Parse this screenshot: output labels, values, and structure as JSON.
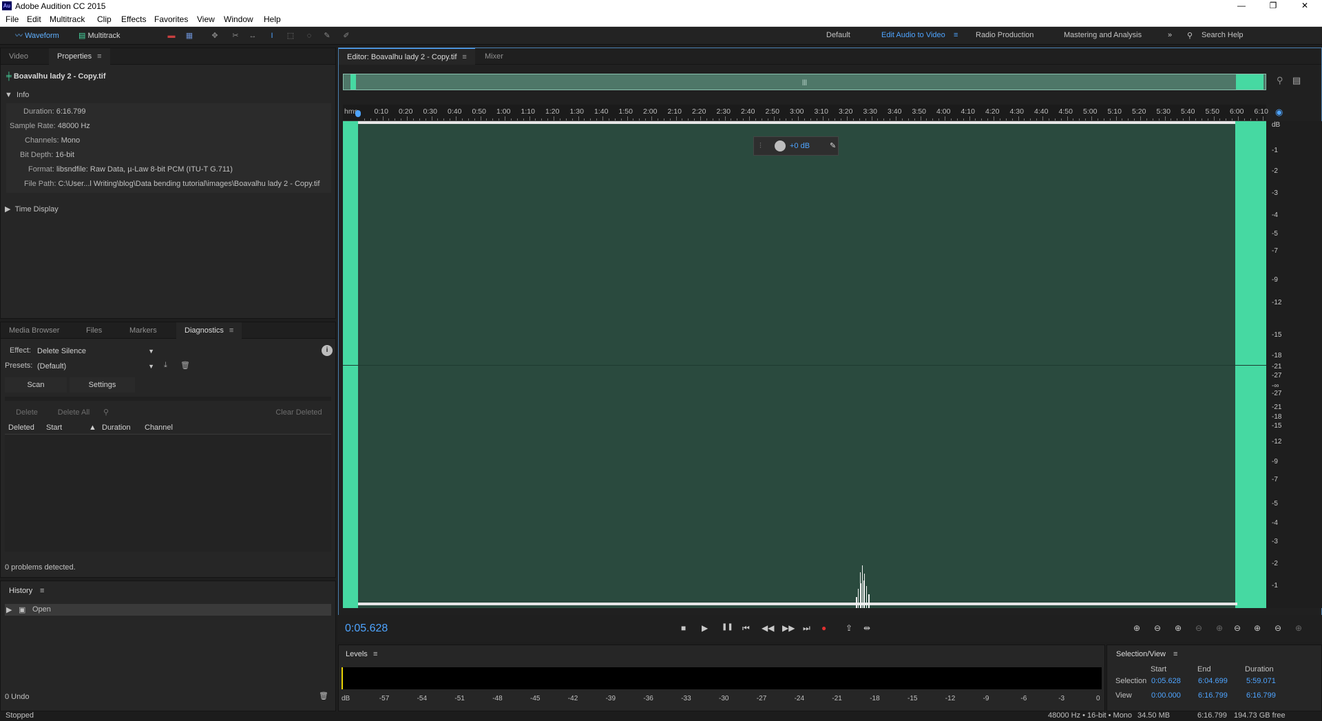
{
  "window": {
    "title": "Adobe Audition CC 2015",
    "logo": "Au"
  },
  "menu": [
    "File",
    "Edit",
    "Multitrack",
    "Clip",
    "Effects",
    "Favorites",
    "View",
    "Window",
    "Help"
  ],
  "toolbar": {
    "waveform": "Waveform",
    "multitrack": "Multitrack",
    "workspaces": [
      "Default",
      "Edit Audio to Video",
      "Radio Production",
      "Mastering and Analysis"
    ],
    "active_workspace": "Edit Audio to Video",
    "overflow": "»",
    "search": "Search Help"
  },
  "properties": {
    "tabs": [
      "Video",
      "Properties"
    ],
    "file_name": "Boavalhu lady 2 - Copy.tif",
    "info_heading": "Info",
    "info": [
      {
        "label": "Duration:",
        "value": "6:16.799"
      },
      {
        "label": "Sample Rate:",
        "value": "48000 Hz"
      },
      {
        "label": "Channels:",
        "value": "Mono"
      },
      {
        "label": "Bit Depth:",
        "value": "16-bit"
      },
      {
        "label": "Format:",
        "value": "libsndfile: Raw Data, µ-Law 8-bit PCM (ITU-T G.711)"
      },
      {
        "label": "File Path:",
        "value": "C:\\User...l Writing\\blog\\Data bending tutorial\\images\\Boavalhu lady 2 - Copy.tif"
      }
    ],
    "time_display": "Time Display"
  },
  "diagnostics": {
    "tabs": [
      "Media Browser",
      "Files",
      "Markers",
      "Diagnostics"
    ],
    "effect_label": "Effect:",
    "effect_value": "Delete Silence",
    "presets_label": "Presets:",
    "presets_value": "(Default)",
    "scan": "Scan",
    "settings": "Settings",
    "delete": "Delete",
    "delete_all": "Delete All",
    "clear_deleted": "Clear Deleted",
    "columns": [
      "Deleted",
      "Start",
      "Duration",
      "Channel"
    ],
    "status": "0 problems detected."
  },
  "history": {
    "title": "History",
    "items": [
      "Open"
    ],
    "undo": "0 Undo"
  },
  "editor": {
    "tab": "Editor: Boavalhu lady 2 - Copy.tif",
    "mixer": "Mixer",
    "ruler_unit": "hms",
    "ruler": [
      "0:10",
      "0:20",
      "0:30",
      "0:40",
      "0:50",
      "1:00",
      "1:10",
      "1:20",
      "1:30",
      "1:40",
      "1:50",
      "2:00",
      "2:10",
      "2:20",
      "2:30",
      "2:40",
      "2:50",
      "3:00",
      "3:10",
      "3:20",
      "3:30",
      "3:40",
      "3:50",
      "4:00",
      "4:10",
      "4:20",
      "4:30",
      "4:40",
      "4:50",
      "5:00",
      "5:10",
      "5:20",
      "5:30",
      "5:40",
      "5:50",
      "6:00",
      "6:10"
    ],
    "db_label": "dB",
    "db_scale": [
      "-1",
      "-2",
      "-3",
      "-4",
      "-5",
      "-7",
      "-9",
      "-12",
      "-15",
      "-18",
      "-21",
      "-27",
      "-∞",
      "-27",
      "-21",
      "-18",
      "-15",
      "-12",
      "-9",
      "-7",
      "-5",
      "-4",
      "-3",
      "-2",
      "-1"
    ],
    "hud_gain": "+0 dB",
    "timecode": "0:05.628",
    "transport": [
      "■",
      "▶",
      "❚❚",
      "⏮",
      "◀◀",
      "▶▶",
      "⏭",
      "●",
      "⇪",
      "⇹"
    ]
  },
  "levels": {
    "title": "Levels",
    "scale": [
      "dB",
      "-57",
      "-54",
      "-51",
      "-48",
      "-45",
      "-42",
      "-39",
      "-36",
      "-33",
      "-30",
      "-27",
      "-24",
      "-21",
      "-18",
      "-15",
      "-12",
      "-9",
      "-6",
      "-3",
      "0"
    ]
  },
  "selection_view": {
    "title": "Selection/View",
    "headers": [
      "Start",
      "End",
      "Duration"
    ],
    "selection_label": "Selection",
    "selection": [
      "0:05.628",
      "6:04.699",
      "5:59.071"
    ],
    "view_label": "View",
    "view": [
      "0:00.000",
      "6:16.799",
      "6:16.799"
    ]
  },
  "status": {
    "left": "Stopped",
    "format": "48000 Hz • 16-bit • Mono",
    "size": "34.50 MB",
    "duration": "6:16.799",
    "free": "194.73 GB free"
  },
  "colors": {
    "accent": "#4ea4ff",
    "wave_bg": "#2a4a3e",
    "selection": "#46d9a2"
  }
}
